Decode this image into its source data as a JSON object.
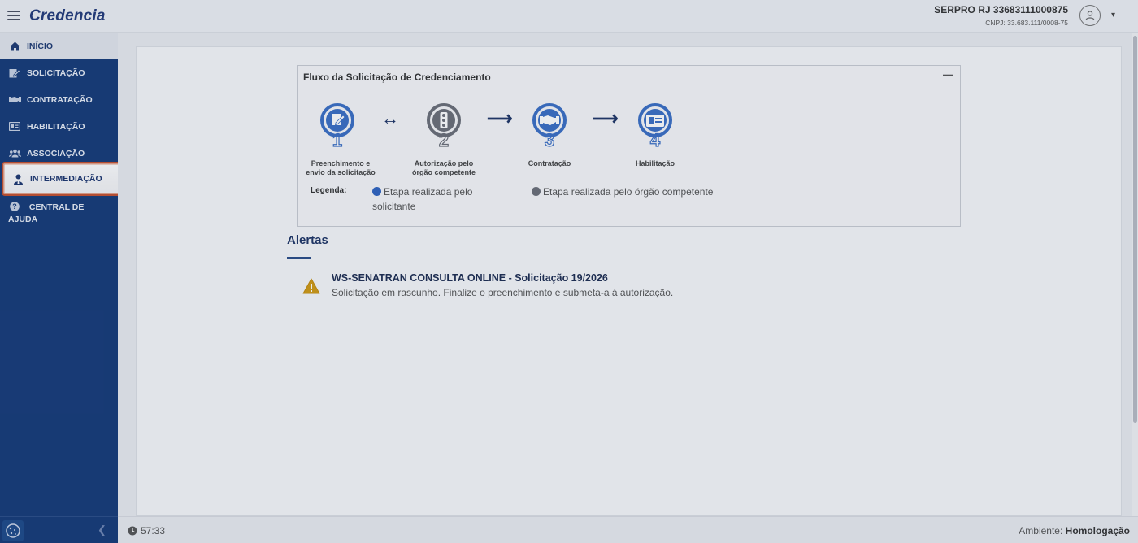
{
  "header": {
    "brand": "Credencia",
    "org_name": "SERPRO RJ 33683111000875",
    "org_cnpj": "CNPJ: 33.683.111/0008-75"
  },
  "sidebar": {
    "items": [
      {
        "label": "INÍCIO",
        "icon": "home-icon"
      },
      {
        "label": "SOLICITAÇÃO",
        "icon": "edit-document-icon"
      },
      {
        "label": "CONTRATAÇÃO",
        "icon": "handshake-icon"
      },
      {
        "label": "HABILITAÇÃO",
        "icon": "id-card-icon"
      },
      {
        "label": "ASSOCIAÇÃO",
        "icon": "users-icon"
      },
      {
        "label": "INTERMEDIAÇÃO",
        "icon": "user-tie-icon"
      },
      {
        "label": "CENTRAL DE AJUDA",
        "icon": "question-circle-icon"
      }
    ]
  },
  "flow": {
    "title": "Fluxo da Solicitação de Credenciamento",
    "steps": [
      {
        "number": "1",
        "caption_line1": "Preenchimento e",
        "caption_line2": "envio da solicitação",
        "icon": "edit-document-icon",
        "color": "#3a6fc4"
      },
      {
        "number": "2",
        "caption_line1": "Autorização pelo",
        "caption_line2": "órgão competente",
        "icon": "traffic-light-icon",
        "color": "#6b6f78"
      },
      {
        "number": "3",
        "caption_line1": "Contratação",
        "caption_line2": "",
        "icon": "handshake-icon",
        "color": "#3a6fc4"
      },
      {
        "number": "4",
        "caption_line1": "Habilitação",
        "caption_line2": "",
        "icon": "id-card-icon",
        "color": "#3a6fc4"
      }
    ],
    "legend_label": "Legenda:",
    "legend_applicant_line1": "Etapa realizada pelo",
    "legend_applicant_line2": "solicitante",
    "legend_agency": "Etapa realizada pelo órgão competente",
    "applicant_color": "#2f64c0",
    "agency_color": "#6b6f78"
  },
  "alerts": {
    "title": "Alertas",
    "items": [
      {
        "title": "WS-SENATRAN CONSULTA ONLINE - Solicitação 19/2026",
        "text": "Solicitação em rascunho. Finalize o preenchimento e submeta-a à autorização.",
        "icon": "warning-icon"
      }
    ]
  },
  "footer": {
    "timer": "57:33",
    "env_label": "Ambiente:",
    "env_value": "Homologação"
  }
}
